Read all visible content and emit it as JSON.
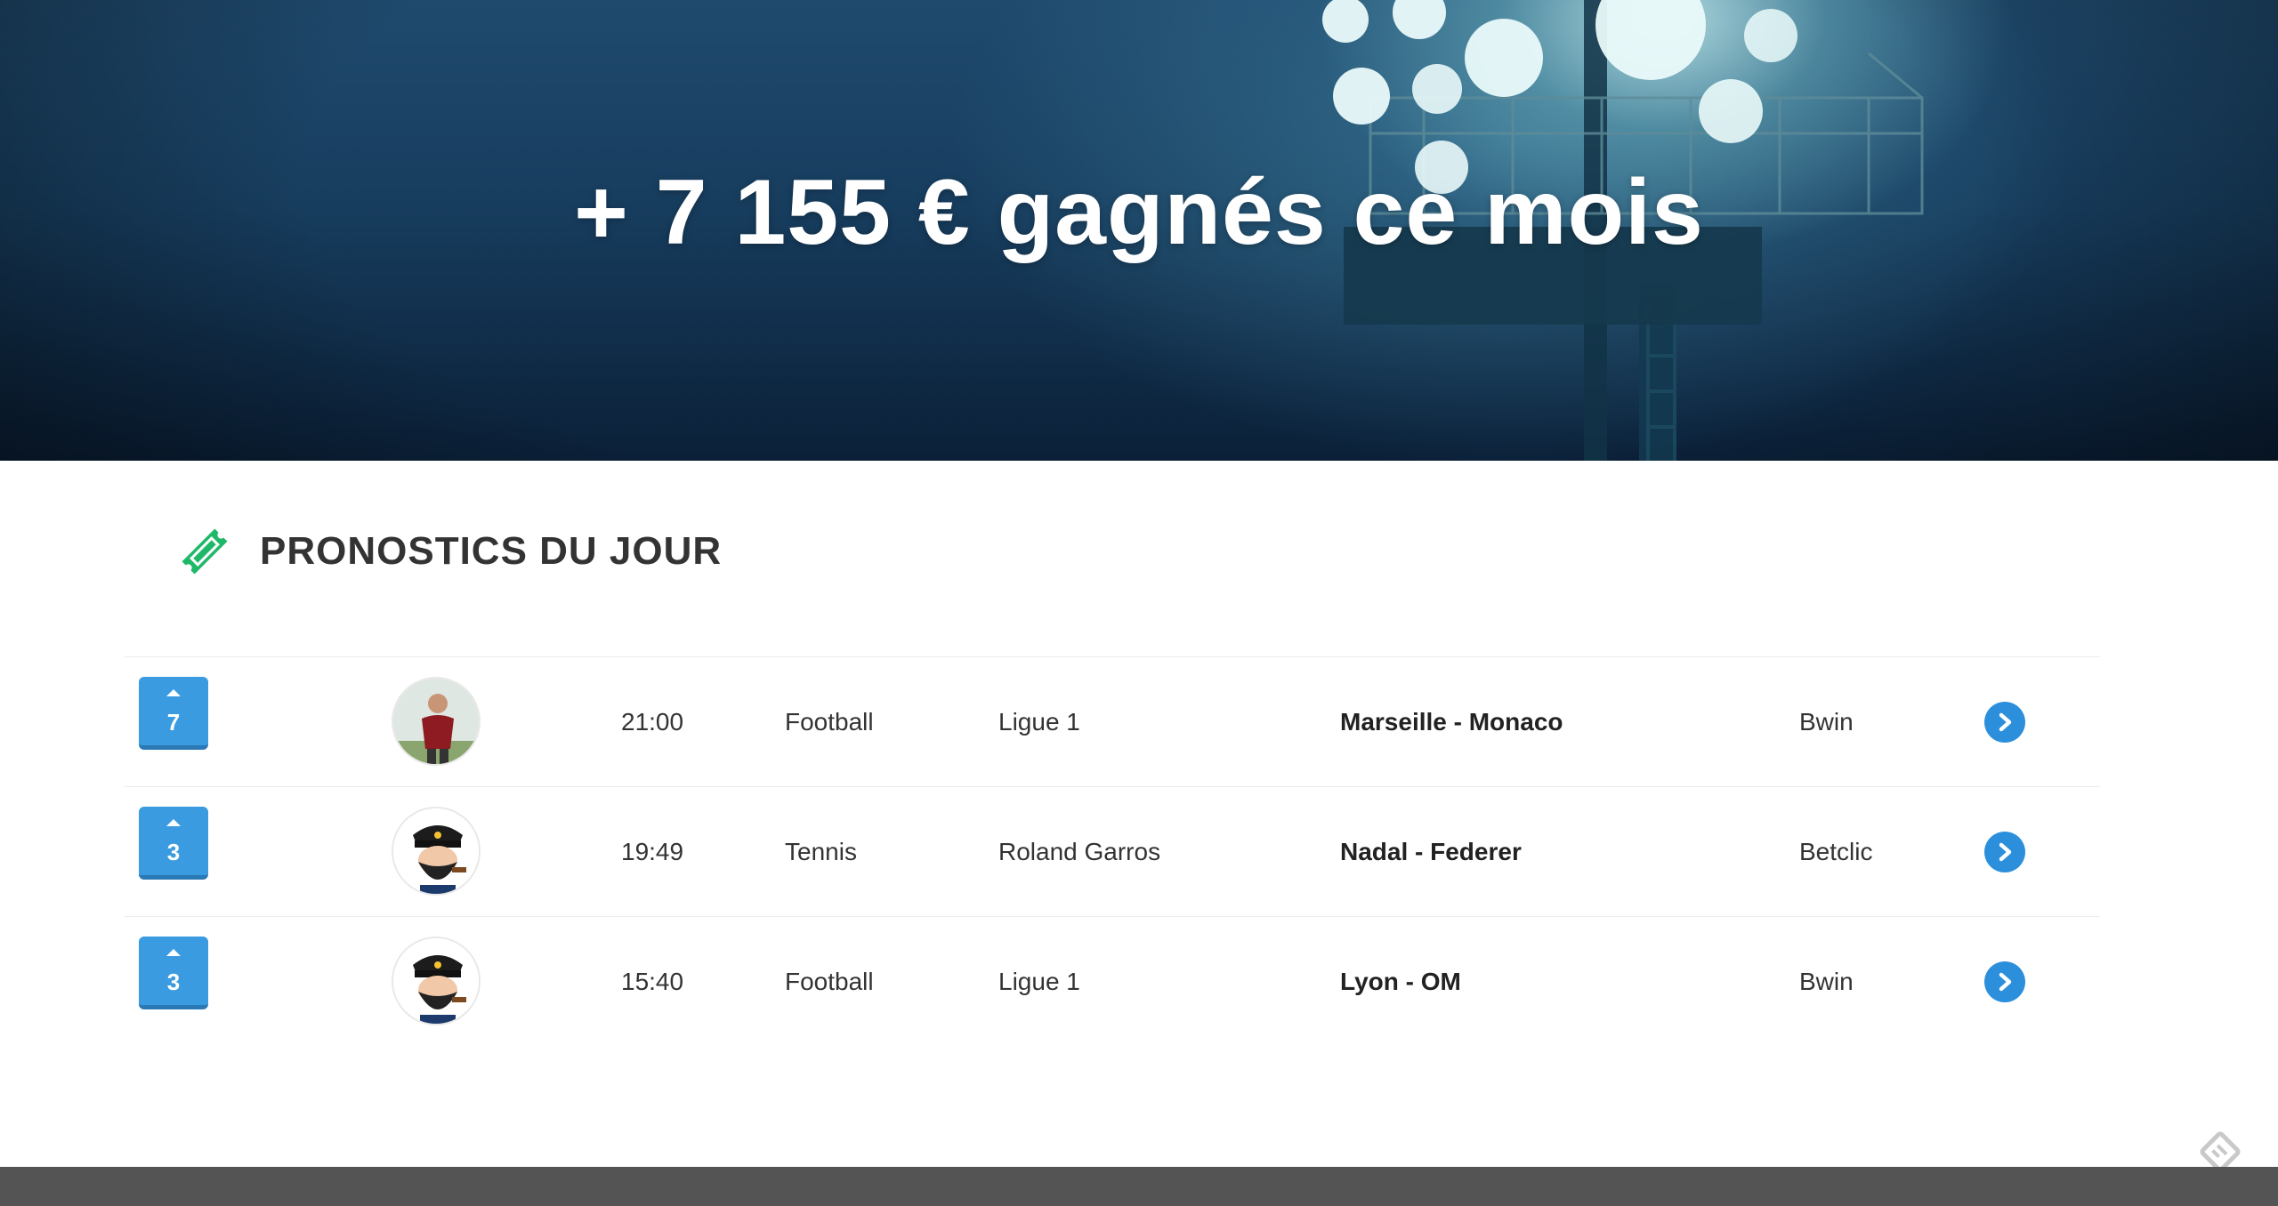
{
  "hero": {
    "title": "+ 7 155 € gagnés ce mois"
  },
  "section": {
    "title": "PRONOSTICS DU JOUR",
    "icon": "ticket-icon",
    "icon_color": "#1fb868"
  },
  "rows": [
    {
      "votes": "7",
      "avatar": "footballer-avatar",
      "time": "21:00",
      "sport": "Football",
      "league": "Ligue 1",
      "match": "Marseille - Monaco",
      "bookmaker": "Bwin"
    },
    {
      "votes": "3",
      "avatar": "captain-avatar",
      "time": "19:49",
      "sport": "Tennis",
      "league": "Roland Garros",
      "match": "Nadal - Federer",
      "bookmaker": "Betclic"
    },
    {
      "votes": "3",
      "avatar": "captain-avatar",
      "time": "15:40",
      "sport": "Football",
      "league": "Ligue 1",
      "match": "Lyon - OM",
      "bookmaker": "Bwin"
    }
  ],
  "colors": {
    "vote_button": "#3a9be0",
    "go_button": "#2c8fdc",
    "footer": "#545454"
  }
}
